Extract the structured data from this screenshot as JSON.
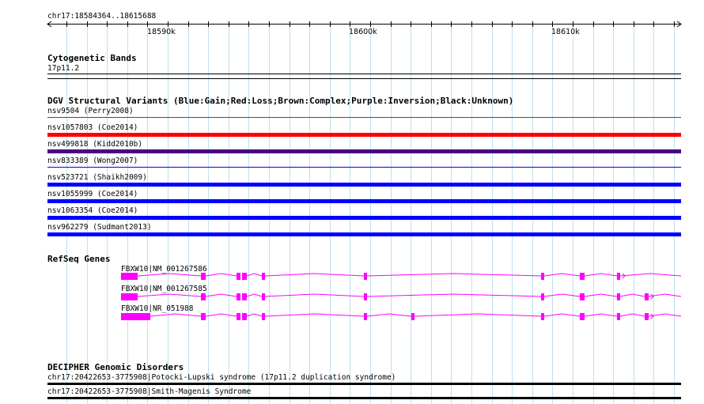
{
  "ruler": {
    "location": "chr17:18584364..18615688",
    "ticks": [
      "18590k",
      "18600k",
      "18610k"
    ]
  },
  "tracks": {
    "cytoband": {
      "title": "Cytogenetic Bands",
      "band": "17p11.2"
    },
    "dgv": {
      "title": "DGV Structural Variants (Blue:Gain;Red:Loss;Brown:Complex;Purple:Inversion;Black:Unknown)",
      "variants": [
        {
          "label": "nsv9504 (Perry2008)",
          "type": "Complex",
          "color": "#8b3a0e"
        },
        {
          "label": "nsv1057803 (Coe2014)",
          "type": "Loss",
          "color": "#ff0000"
        },
        {
          "label": "nsv499818 (Kidd2010b)",
          "type": "Inversion",
          "color": "#4b0082"
        },
        {
          "label": "nsv833389 (Wong2007)",
          "type": "Gain",
          "color": "#0000ff"
        },
        {
          "label": "nsv523721 (Shaikh2009)",
          "type": "Gain",
          "color": "#0000ff"
        },
        {
          "label": "nsv1055999 (Coe2014)",
          "type": "Gain",
          "color": "#0000ff"
        },
        {
          "label": "nsv1063354 (Coe2014)",
          "type": "Gain",
          "color": "#0000ff"
        },
        {
          "label": "nsv962279 (Sudmant2013)",
          "type": "Gain",
          "color": "#0000ff"
        }
      ]
    },
    "refseq": {
      "title": "RefSeq Genes",
      "gene_color": "#ff00ff",
      "transcripts": [
        {
          "label": "FBXW10|NM_001267586"
        },
        {
          "label": "FBXW10|NM_001267585"
        },
        {
          "label": "FBXW10|NR_051988"
        }
      ]
    },
    "decipher": {
      "title": "DECIPHER Genomic Disorders",
      "entries": [
        {
          "label": "chr17:20422653-3775908|Potocki-Lupski syndrome (17p11.2 duplication syndrome)"
        },
        {
          "label": "chr17:20422653-3775908|Smith-Magenis Syndrome"
        }
      ]
    }
  },
  "colors": {
    "grid": "#bfe0f0",
    "gene": "#ff00ff",
    "gain": "#0000ff",
    "loss": "#ff0000",
    "complex": "#8b3a0e",
    "inversion": "#4b0082",
    "unknown": "#000000"
  }
}
